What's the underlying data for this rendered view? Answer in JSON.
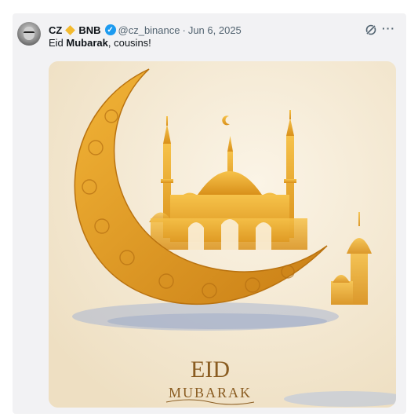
{
  "post": {
    "author_name": "CZ",
    "author_tag": "BNB",
    "handle": "@cz_binance",
    "separator": "·",
    "date": "Jun 6, 2025",
    "text_prefix": "Eid ",
    "text_bold": "Mubarak",
    "text_suffix": ", cousins!"
  },
  "icons": {
    "avatar": "avatar",
    "bnb": "bnb-diamond-icon",
    "verified": "verified-badge-icon",
    "grok": "grok-icon",
    "more": "more-icon",
    "moon_emoji": "crescent-moon-emoji"
  },
  "media": {
    "line1": "EID",
    "line2": "MUBARAK"
  },
  "colors": {
    "bnb": "#f3ba2f",
    "verified": "#1d9bf0",
    "gold": "#e8a826",
    "cream": "#f3ead8"
  }
}
